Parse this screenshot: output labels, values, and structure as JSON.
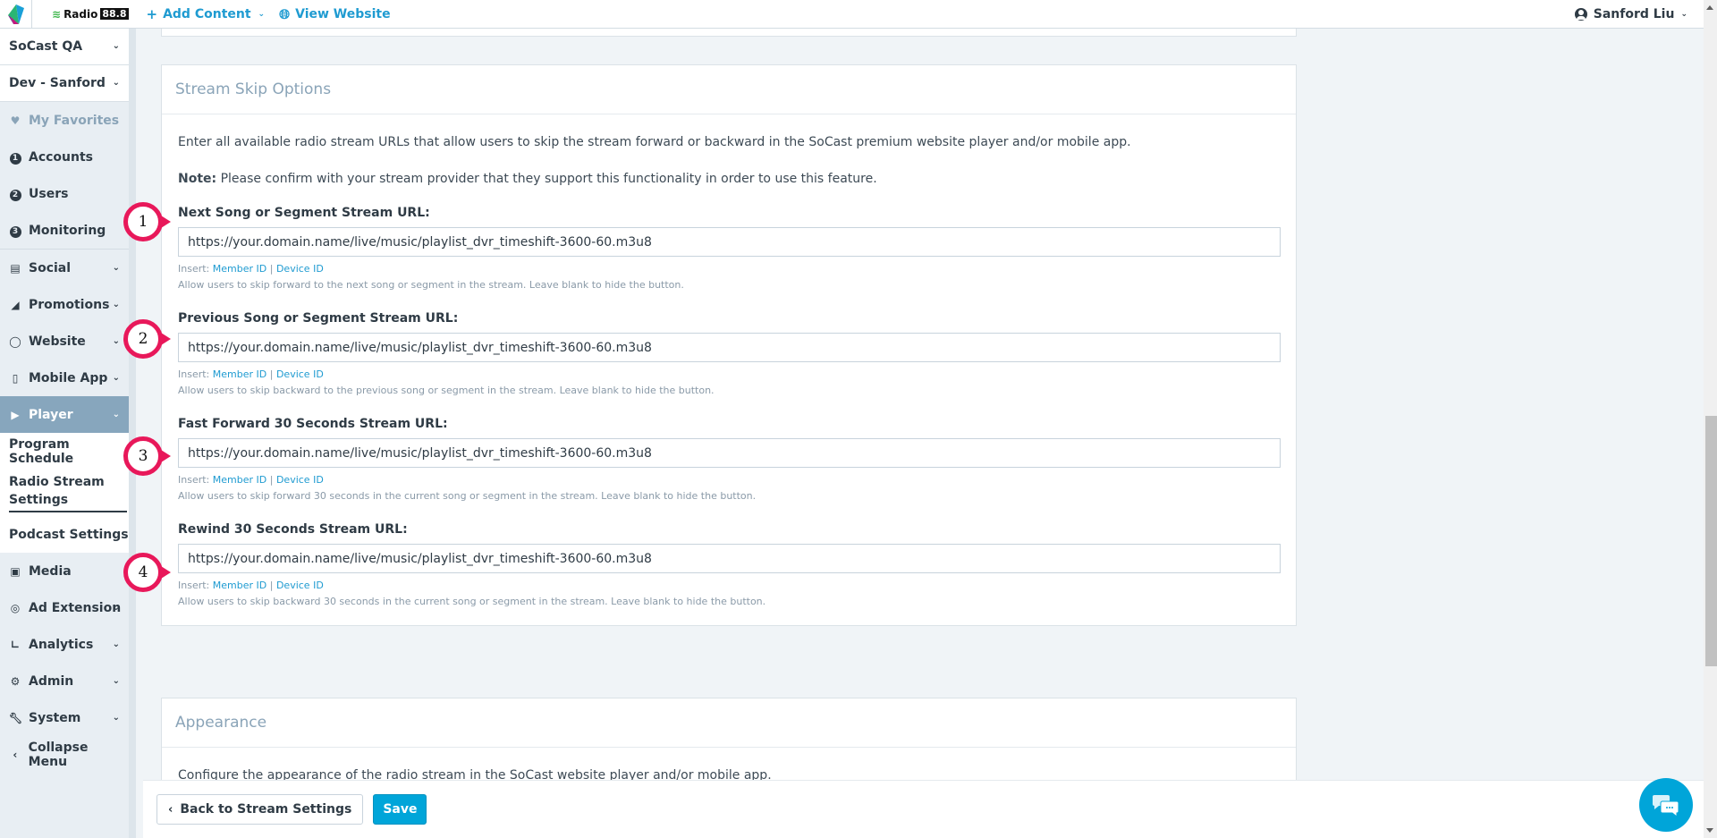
{
  "topbar": {
    "brand_name": "Radio",
    "brand_number": "88.8",
    "add_content_label": "Add Content",
    "view_website_label": "View Website",
    "user_name": "Sanford Liu"
  },
  "sidebar": {
    "org_selector": "SoCast QA",
    "site_selector": "Dev - Sanford",
    "favorites": "My Favorites",
    "items": [
      {
        "label": "Accounts",
        "icon": "1"
      },
      {
        "label": "Users",
        "icon": "2"
      },
      {
        "label": "Monitoring",
        "icon": "3"
      },
      {
        "label": "Social"
      },
      {
        "label": "Promotions"
      },
      {
        "label": "Website"
      },
      {
        "label": "Mobile App"
      },
      {
        "label": "Player"
      },
      {
        "label": "Program Schedule"
      },
      {
        "label": "Radio Stream Settings"
      },
      {
        "label": "Podcast Settings"
      },
      {
        "label": "Media"
      },
      {
        "label": "Ad Extension"
      },
      {
        "label": "Analytics"
      },
      {
        "label": "Admin"
      },
      {
        "label": "System"
      },
      {
        "label": "Collapse Menu"
      }
    ]
  },
  "stream_skip": {
    "title": "Stream Skip Options",
    "intro": "Enter all available radio stream URLs that allow users to skip the stream forward or backward in the SoCast premium website player and/or mobile app.",
    "note_label": "Note:",
    "note_text": " Please confirm with your stream provider that they support this functionality in order to use this feature.",
    "insert_label": "Insert:",
    "member_id_link": "Member ID",
    "separator": "|",
    "device_id_link": "Device ID",
    "fields": [
      {
        "marker": "1",
        "label": "Next Song or Segment Stream URL:",
        "value": "https://your.domain.name/live/music/playlist_dvr_timeshift-3600-60.m3u8",
        "help": "Allow users to skip forward to the next song or segment in the stream. Leave blank to hide the button."
      },
      {
        "marker": "2",
        "label": "Previous Song or Segment Stream URL:",
        "value": "https://your.domain.name/live/music/playlist_dvr_timeshift-3600-60.m3u8",
        "help": "Allow users to skip backward to the previous song or segment in the stream. Leave blank to hide the button."
      },
      {
        "marker": "3",
        "label": "Fast Forward 30 Seconds Stream URL:",
        "value": "https://your.domain.name/live/music/playlist_dvr_timeshift-3600-60.m3u8",
        "help": "Allow users to skip forward 30 seconds in the current song or segment in the stream. Leave blank to hide the button."
      },
      {
        "marker": "4",
        "label": "Rewind 30 Seconds Stream URL:",
        "value": "https://your.domain.name/live/music/playlist_dvr_timeshift-3600-60.m3u8",
        "help": "Allow users to skip backward 30 seconds in the current song or segment in the stream. Leave blank to hide the button."
      }
    ]
  },
  "appearance": {
    "title": "Appearance",
    "intro": "Configure the appearance of the radio stream in the SoCast website player and/or mobile app."
  },
  "footer": {
    "back_label": "Back to Stream Settings",
    "save_label": "Save"
  },
  "colors": {
    "accent": "#1f9bd1",
    "save_button": "#00a5d9",
    "sidebar_active": "#87a6bd",
    "annotation": "#e8185a"
  }
}
